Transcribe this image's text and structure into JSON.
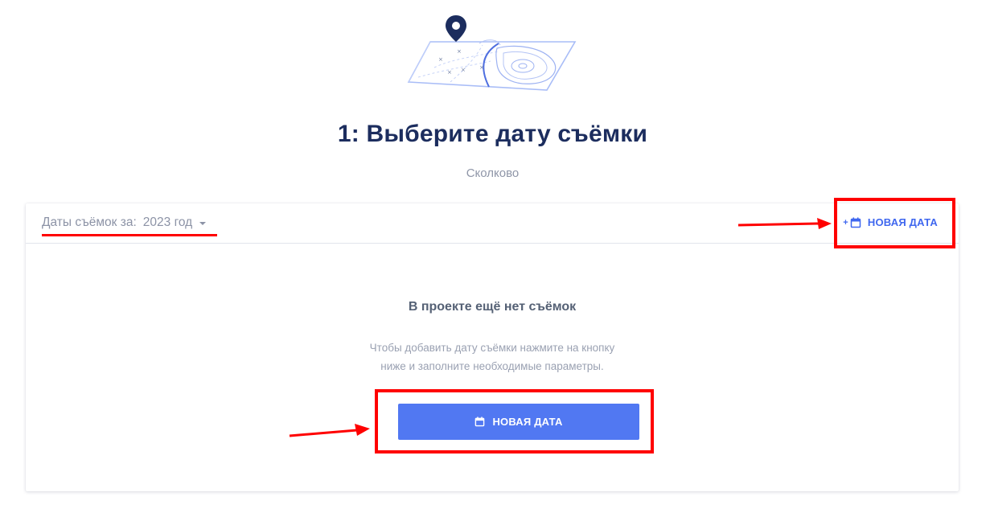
{
  "page": {
    "title": "1: Выберите дату съёмки",
    "subtitle": "Сколково"
  },
  "filter": {
    "label": "Даты съёмок за:",
    "value": "2023 год",
    "icon": "caret-down-icon"
  },
  "header_action": {
    "plus": "+",
    "label": "НОВАЯ ДАТА",
    "icon": "calendar-icon"
  },
  "empty_state": {
    "title": "В проекте ещё нет съёмок",
    "hint_line1": "Чтобы добавить дату съёмки нажмите на кнопку",
    "hint_line2": "ниже и заполните необходимые параметры."
  },
  "main_action": {
    "label": "НОВАЯ ДАТА",
    "icon": "calendar-icon"
  },
  "colors": {
    "accent": "#5178f2",
    "link": "#3f67ef",
    "title": "#1c2d5e",
    "annotation": "#ff0000"
  }
}
